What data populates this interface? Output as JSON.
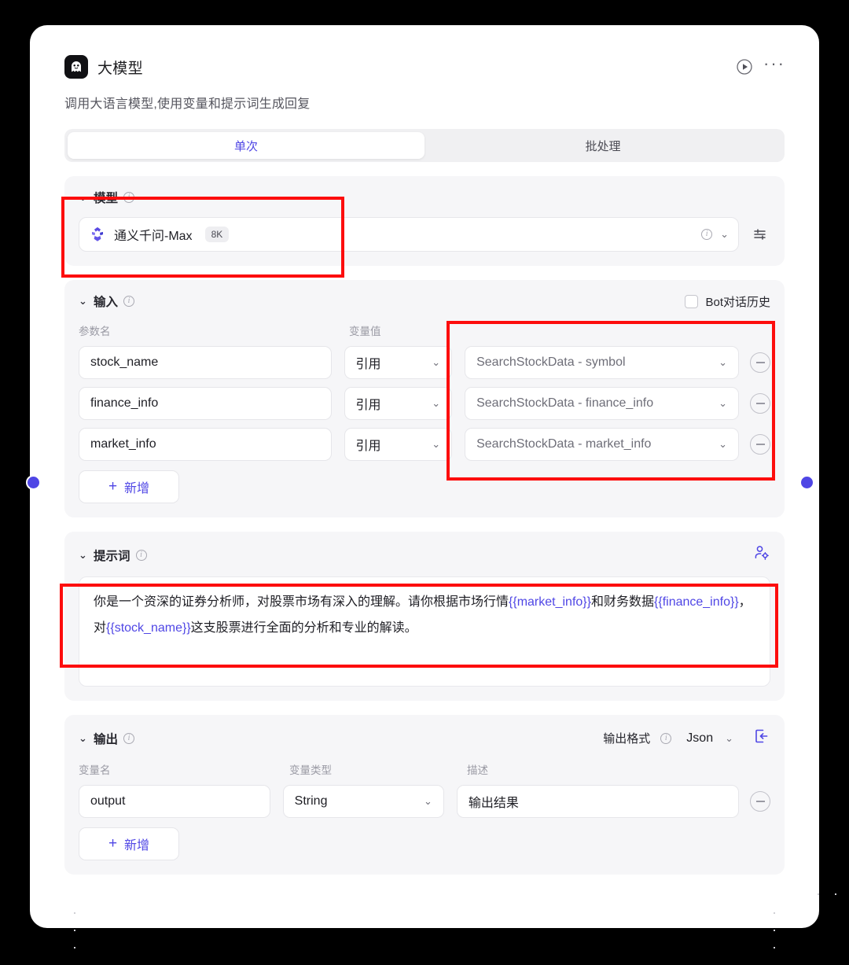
{
  "node": {
    "icon": "ghost-robot-icon",
    "title": "大模型",
    "description": "调用大语言模型,使用变量和提示词生成回复",
    "run_icon": "play-circle-icon",
    "more_icon": "ellipsis-icon"
  },
  "tabs": [
    {
      "label": "单次",
      "active": true
    },
    {
      "label": "批处理",
      "active": false
    }
  ],
  "model_section": {
    "title": "模型",
    "info_icon": "info-icon",
    "collapse_icon": "chevron-down-icon",
    "selected_model": "通义千问-Max",
    "context_badge": "8K",
    "model_logo": "tongyi-qianwen-logo",
    "row_info_icon": "info-icon",
    "row_chevron_icon": "chevron-down-icon",
    "settings_icon": "sliders-settings-icon"
  },
  "input_section": {
    "title": "输入",
    "info_icon": "info-icon",
    "collapse_icon": "chevron-down-icon",
    "bot_history": {
      "label": "Bot对话历史",
      "checked": false
    },
    "columns": {
      "name": "参数名",
      "value": "变量值"
    },
    "rows": [
      {
        "name": "stock_name",
        "mode": "引用",
        "reference": "SearchStockData - symbol"
      },
      {
        "name": "finance_info",
        "mode": "引用",
        "reference": "SearchStockData - finance_info"
      },
      {
        "name": "market_info",
        "mode": "引用",
        "reference": "SearchStockData - market_info"
      }
    ],
    "add_label": "新增",
    "add_icon": "plus-icon",
    "remove_icon": "minus-circle-icon"
  },
  "prompt_section": {
    "title": "提示词",
    "info_icon": "info-icon",
    "collapse_icon": "chevron-down-icon",
    "persona_icon": "user-settings-icon",
    "text_parts": [
      {
        "t": "你是一个资深的证券分析师，对股票市场有深入的理解。请你根据市场行情",
        "v": false
      },
      {
        "t": "{{market_info}}",
        "v": true
      },
      {
        "t": "和财务数据",
        "v": false
      },
      {
        "t": "{{finance_info}}",
        "v": true
      },
      {
        "t": "，对",
        "v": false
      },
      {
        "t": "{{stock_name}}",
        "v": true
      },
      {
        "t": "这支股票进行全面的分析和专业的解读。",
        "v": false
      }
    ]
  },
  "output_section": {
    "title": "输出",
    "info_icon": "info-icon",
    "collapse_icon": "chevron-down-icon",
    "format_label": "输出格式",
    "format_info_icon": "info-icon",
    "format_value": "Json",
    "format_chevron_icon": "chevron-down-icon",
    "import_icon": "import-arrow-icon",
    "columns": {
      "name": "变量名",
      "type": "变量类型",
      "desc": "描述"
    },
    "rows": [
      {
        "name": "output",
        "type": "String",
        "desc": "输出结果"
      }
    ],
    "add_label": "新增",
    "add_icon": "plus-icon",
    "remove_icon": "minus-circle-icon"
  },
  "connectors": {
    "left": "input-port",
    "right": "output-port",
    "color": "#4f46e5"
  },
  "annotations": {
    "color": "#fd0d0d",
    "count": 3
  }
}
